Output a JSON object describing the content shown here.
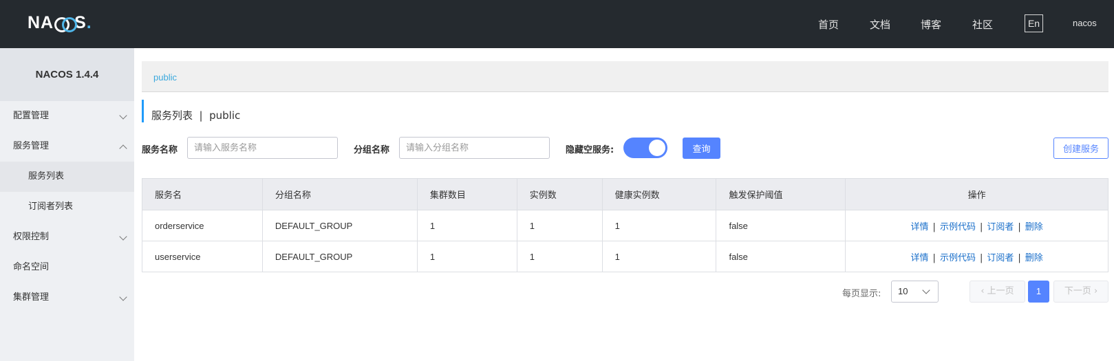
{
  "header": {
    "logo": "NACOS.",
    "nav": [
      "首页",
      "文档",
      "博客",
      "社区"
    ],
    "lang": "En",
    "user": "nacos"
  },
  "sidebar": {
    "title": "NACOS 1.4.4",
    "items": [
      {
        "label": "配置管理",
        "expandable": true
      },
      {
        "label": "服务管理",
        "expandable": true,
        "expanded": true
      },
      {
        "label": "服务列表",
        "sub": true,
        "active": true
      },
      {
        "label": "订阅者列表",
        "sub": true
      },
      {
        "label": "权限控制",
        "expandable": true
      },
      {
        "label": "命名空间"
      },
      {
        "label": "集群管理",
        "expandable": true
      }
    ]
  },
  "breadcrumb": "public",
  "page_title": "服务列表  |  public",
  "filters": {
    "service_name_label": "服务名称",
    "service_name_placeholder": "请输入服务名称",
    "group_name_label": "分组名称",
    "group_name_placeholder": "请输入分组名称",
    "hide_empty_label": "隐藏空服务:",
    "hide_empty_on": true,
    "query_button": "查询",
    "create_button": "创建服务"
  },
  "table": {
    "columns": [
      "服务名",
      "分组名称",
      "集群数目",
      "实例数",
      "健康实例数",
      "触发保护阈值",
      "操作"
    ],
    "rows": [
      {
        "name": "orderservice",
        "group": "DEFAULT_GROUP",
        "clusters": "1",
        "instances": "1",
        "healthy": "1",
        "threshold": "false"
      },
      {
        "name": "userservice",
        "group": "DEFAULT_GROUP",
        "clusters": "1",
        "instances": "1",
        "healthy": "1",
        "threshold": "false"
      }
    ],
    "actions": [
      "详情",
      "示例代码",
      "订阅者",
      "删除"
    ]
  },
  "pagination": {
    "per_page_label": "每页显示:",
    "per_page_value": "10",
    "prev": "上一页",
    "current_page": "1",
    "next": "下一页"
  },
  "colors": {
    "header_bg": "#252a2f",
    "primary": "#5584ff",
    "link": "#1a6fca",
    "breadcrumb": "#39a8dd"
  }
}
